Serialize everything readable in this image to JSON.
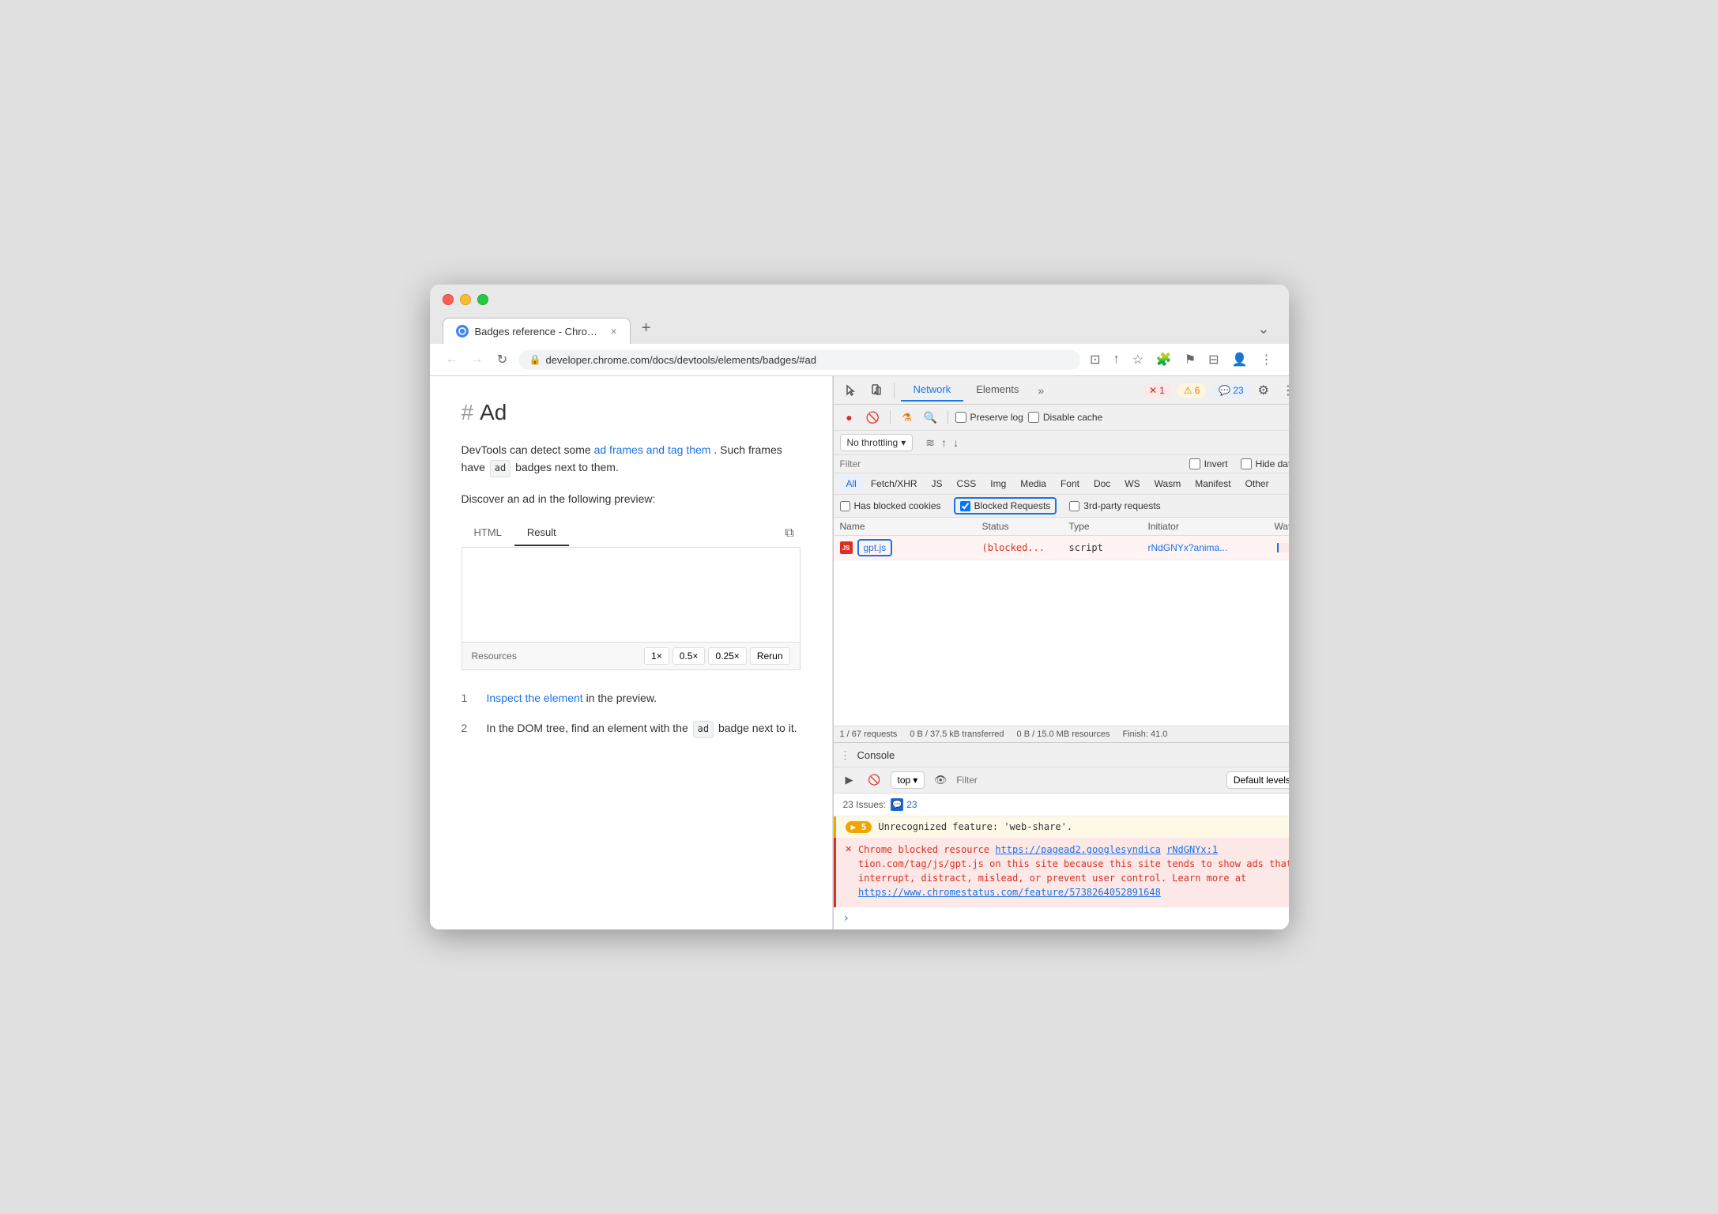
{
  "browser": {
    "tab_title": "Badges reference - Chrome De",
    "tab_close": "×",
    "new_tab": "+",
    "address": "developer.chrome.com/docs/devtools/elements/badges/#ad",
    "nav_back": "←",
    "nav_forward": "→",
    "nav_reload": "↻"
  },
  "page": {
    "hash_symbol": "#",
    "heading": "Ad",
    "paragraph1_pre": "DevTools can detect some ",
    "paragraph1_link1": "ad frames and tag them",
    "paragraph1_mid": ". Such frames have",
    "paragraph1_badge": "ad",
    "paragraph1_post": "badges next to them.",
    "paragraph2": "Discover an ad in the following preview:",
    "preview_tab_html": "HTML",
    "preview_tab_result": "Result",
    "resources_label": "Resources",
    "resources_1x": "1×",
    "resources_0_5x": "0.5×",
    "resources_0_25x": "0.25×",
    "resources_rerun": "Rerun",
    "steps": [
      {
        "num": "1",
        "text_pre": "",
        "link": "Inspect the element",
        "text_post": " in the preview."
      },
      {
        "num": "2",
        "text_pre": "In the DOM tree, find an element with the",
        "badge": "ad",
        "text_post": "badge next to it."
      }
    ]
  },
  "devtools": {
    "tabs": [
      "Network",
      "Elements"
    ],
    "more_label": "»",
    "active_tab": "Network",
    "badge_error_icon": "✕",
    "badge_error_count": "1",
    "badge_warning_icon": "⚠",
    "badge_warning_count": "6",
    "badge_info_icon": "💬",
    "badge_info_count": "23",
    "toolbar_icons": {
      "cursor": "⬚",
      "device": "📱"
    }
  },
  "network": {
    "record_btn": "●",
    "clear_btn": "🚫",
    "filter_icon": "⚗",
    "search_icon": "🔍",
    "preserve_log_label": "Preserve log",
    "disable_cache_label": "Disable cache",
    "settings_icon": "⚙",
    "throttle_label": "No throttling",
    "wifi_icon": "≋",
    "upload_icon": "↑",
    "download_icon": "↓",
    "filter_placeholder": "Filter",
    "invert_label": "Invert",
    "hide_data_urls_label": "Hide data URLs",
    "type_filters": [
      "All",
      "Fetch/XHR",
      "JS",
      "CSS",
      "Img",
      "Media",
      "Font",
      "Doc",
      "WS",
      "Wasm",
      "Manifest",
      "Other"
    ],
    "active_type_filter": "All",
    "has_blocked_cookies_label": "Has blocked cookies",
    "blocked_requests_label": "Blocked Requests",
    "blocked_requests_checked": true,
    "third_party_label": "3rd-party requests",
    "table": {
      "headers": [
        "Name",
        "Status",
        "Type",
        "Initiator",
        "Waterfall"
      ],
      "rows": [
        {
          "name": "gpt.js",
          "status": "(blocked...",
          "type": "script",
          "initiator": "rNdGNYx?anima...",
          "has_ad_badge": true
        }
      ]
    },
    "status_bar": "1 / 67 requests | 0 B / 37.5 kB transferred | 0 B / 15.0 MB resources | Finish: 41.0"
  },
  "console": {
    "title": "Console",
    "close_icon": "×",
    "execute_btn": "▶",
    "clear_btn": "🚫",
    "context_label": "top",
    "context_dropdown": "▾",
    "eye_icon": "👁",
    "filter_placeholder": "Filter",
    "levels_label": "Default levels",
    "levels_dropdown": "▾",
    "settings_icon": "⚙",
    "issues_label": "23 Issues:",
    "issues_count": "23",
    "warning": {
      "count": "5",
      "text": "Unrecognized feature: 'web-share'."
    },
    "error": {
      "pre_text": "Chrome blocked resource ",
      "link1": "https://pagead2.googlesyndica",
      "link2": "rNdGNYx:1",
      "mid_text": "tion.com/tag/js/gpt.js",
      "description": " on this site because this site tends to show ads that interrupt, distract, mislead, or prevent user control. Learn more at ",
      "link3": "https://www.chromestatus.com/feature/5738264052891648"
    }
  }
}
